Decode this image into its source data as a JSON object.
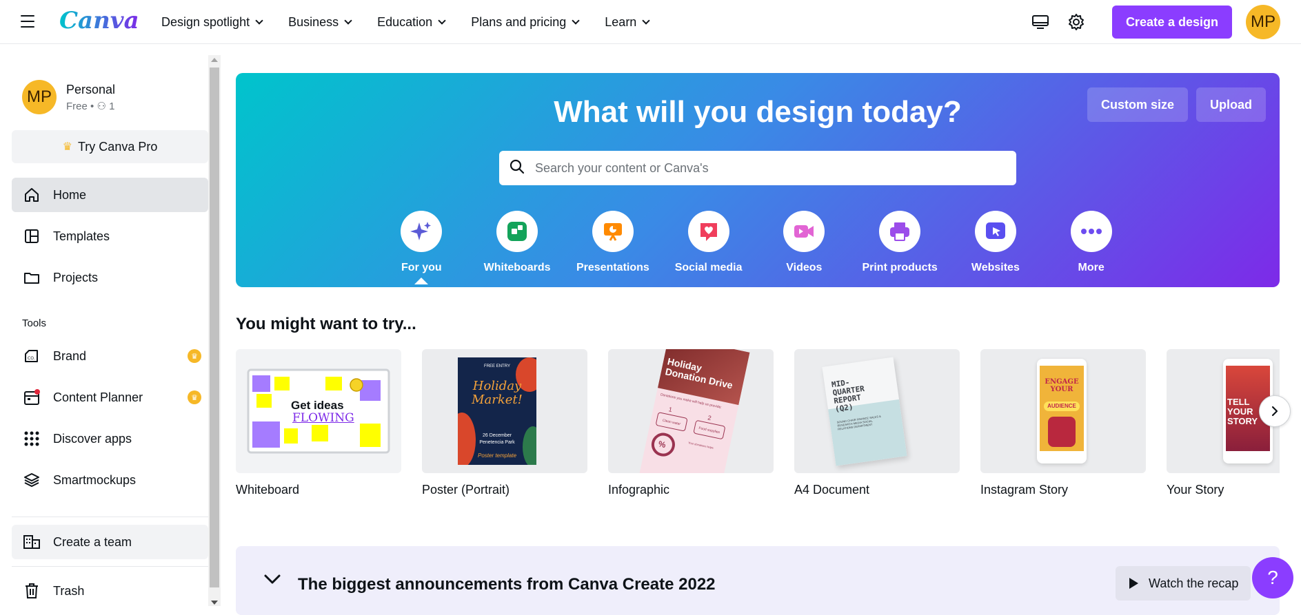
{
  "header": {
    "logo": "Canva",
    "menu": [
      {
        "label": "Design spotlight"
      },
      {
        "label": "Business"
      },
      {
        "label": "Education"
      },
      {
        "label": "Plans and pricing"
      },
      {
        "label": "Learn"
      }
    ],
    "create_label": "Create a design",
    "avatar_initials": "MP"
  },
  "sidebar": {
    "account": {
      "initials": "MP",
      "name": "Personal",
      "plan": "Free",
      "members": "1"
    },
    "try_pro": "Try Canva Pro",
    "items": [
      {
        "label": "Home",
        "icon": "home-icon"
      },
      {
        "label": "Templates",
        "icon": "templates-icon"
      },
      {
        "label": "Projects",
        "icon": "folder-icon"
      }
    ],
    "tools_label": "Tools",
    "tools": [
      {
        "label": "Brand",
        "icon": "brand-icon",
        "pro": true
      },
      {
        "label": "Content Planner",
        "icon": "calendar-icon",
        "pro": true
      },
      {
        "label": "Discover apps",
        "icon": "apps-grid-icon",
        "pro": false
      },
      {
        "label": "Smartmockups",
        "icon": "layers-icon",
        "pro": false
      }
    ],
    "create_team": "Create a team",
    "trash": "Trash"
  },
  "hero": {
    "title": "What will you design today?",
    "custom_size": "Custom size",
    "upload": "Upload",
    "search_placeholder": "Search your content or Canva's",
    "categories": [
      {
        "label": "For you",
        "icon": "sparkle-icon",
        "color": "#5b5bd6"
      },
      {
        "label": "Whiteboards",
        "icon": "whiteboard-icon",
        "color": "#13a35a"
      },
      {
        "label": "Presentations",
        "icon": "presentation-icon",
        "color": "#ff8a00"
      },
      {
        "label": "Social media",
        "icon": "heart-icon",
        "color": "#f03e5c"
      },
      {
        "label": "Videos",
        "icon": "video-icon",
        "color": "#e264d4"
      },
      {
        "label": "Print products",
        "icon": "printer-icon",
        "color": "#9b4dea"
      },
      {
        "label": "Websites",
        "icon": "cursor-icon",
        "color": "#5a4ff0"
      },
      {
        "label": "More",
        "icon": "more-icon",
        "color": "#6d4cf0"
      }
    ]
  },
  "suggestions": {
    "title": "You might want to try...",
    "items": [
      {
        "label": "Whiteboard",
        "thumb_text": "Get ideas",
        "thumb_text2": "FLOWING"
      },
      {
        "label": "Poster (Portrait)",
        "thumb_text": "Holiday Market!",
        "thumb_top": "FREE ENTRY",
        "thumb_date": "26 December",
        "thumb_place": "Penetencia Park",
        "thumb_foot": "Poster template"
      },
      {
        "label": "Infographic",
        "thumb_text": "Holiday Donation Drive",
        "thumb_sub": "Donations you make will help us provide:",
        "thumb_b1": "Clean water",
        "thumb_b2": "Food supplies",
        "thumb_num1": "1",
        "thumb_num2": "2",
        "thumb_small": "Your donations helps",
        "thumb_pct": "%"
      },
      {
        "label": "A4 Document",
        "thumb_text": "MID-QUARTER REPORT (Q2)",
        "thumb_sub": "SOUND CHAIR FINANCE SALES & RESEARCH MEDIA SOCIAL RELATIONS DEPARTMENT"
      },
      {
        "label": "Instagram Story",
        "thumb_text": "ENGAGE YOUR",
        "thumb_badge": "AUDIENCE"
      },
      {
        "label": "Your Story",
        "thumb_text": "TELL YOUR STORY"
      }
    ]
  },
  "announcement": {
    "title": "The biggest announcements from Canva Create 2022",
    "watch": "Watch the recap"
  },
  "help_label": "?"
}
